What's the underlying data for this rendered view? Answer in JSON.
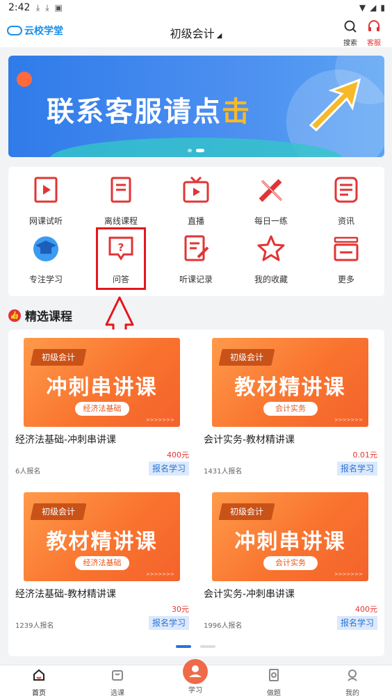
{
  "status_bar": {
    "time": "2:42"
  },
  "header": {
    "logo_text": "云校学堂",
    "title": "初级会计",
    "caret": "◢",
    "search_label": "搜索",
    "service_label": "客服"
  },
  "banner": {
    "text_main": "联系客服请点",
    "text_highlight": "击"
  },
  "grid": {
    "items": [
      {
        "label": "网课试听",
        "icon": "video-book-icon"
      },
      {
        "label": "离线课程",
        "icon": "offline-book-icon"
      },
      {
        "label": "直播",
        "icon": "tv-icon"
      },
      {
        "label": "每日一练",
        "icon": "pencil-ruler-icon"
      },
      {
        "label": "资讯",
        "icon": "news-icon"
      },
      {
        "label": "专注学习",
        "icon": "graduation-cap-icon"
      },
      {
        "label": "问答",
        "icon": "question-bubble-icon"
      },
      {
        "label": "听课记录",
        "icon": "edit-document-icon"
      },
      {
        "label": "我的收藏",
        "icon": "star-icon"
      },
      {
        "label": "更多",
        "icon": "more-list-icon"
      }
    ]
  },
  "section": {
    "title": "精选课程"
  },
  "courses": [
    {
      "tag": "初级会计",
      "headline": "冲刺串讲课",
      "subject": "经济法基础",
      "title": "经济法基础-冲刺串讲课",
      "price": "400元",
      "enrolled": "6人报名",
      "action": "报名学习"
    },
    {
      "tag": "初级会计",
      "headline": "教材精讲课",
      "subject": "会计实务",
      "title": "会计实务-教材精讲课",
      "price": "0.01元",
      "enrolled": "1431人报名",
      "action": "报名学习"
    },
    {
      "tag": "初级会计",
      "headline": "教材精讲课",
      "subject": "经济法基础",
      "title": "经济法基础-教材精讲课",
      "price": "30元",
      "enrolled": "1239人报名",
      "action": "报名学习"
    },
    {
      "tag": "初级会计",
      "headline": "冲刺串讲课",
      "subject": "会计实务",
      "title": "会计实务-冲刺串讲课",
      "price": "400元",
      "enrolled": "1996人报名",
      "action": "报名学习"
    }
  ],
  "bottom_nav": [
    {
      "label": "首页",
      "icon": "home-icon",
      "active": true
    },
    {
      "label": "选课",
      "icon": "cart-icon",
      "active": false
    },
    {
      "label": "学习",
      "icon": "study-icon",
      "active": false
    },
    {
      "label": "做题",
      "icon": "exercise-icon",
      "active": false
    },
    {
      "label": "我的",
      "icon": "profile-icon",
      "active": false
    }
  ],
  "colors": {
    "accent": "#e23434",
    "brand_blue": "#1a8fe8",
    "course_orange": "#f9742f",
    "link_blue": "#2a73d9"
  }
}
